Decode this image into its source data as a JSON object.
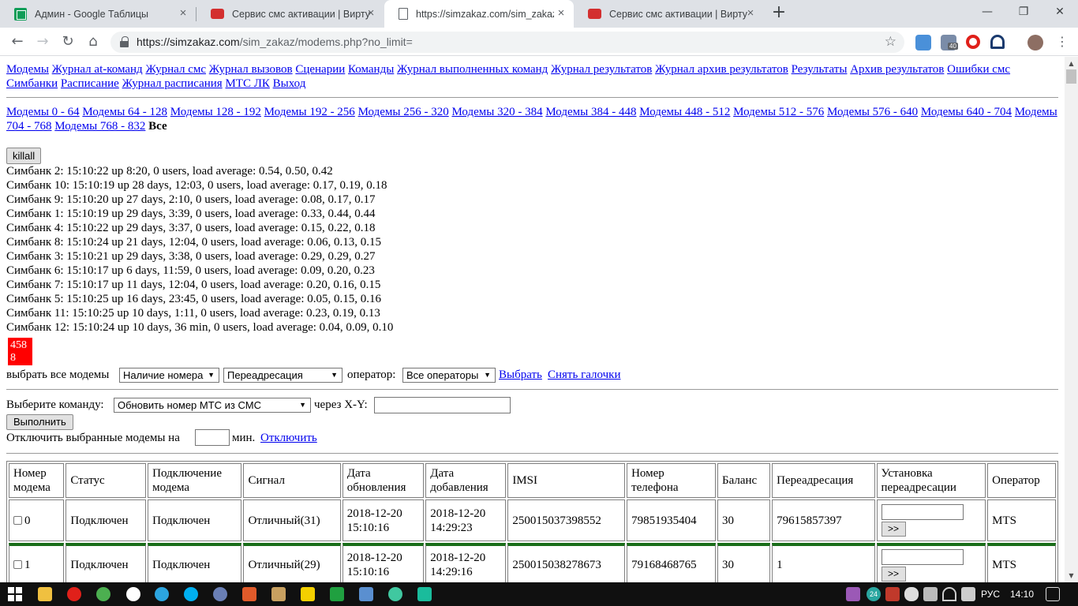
{
  "browser": {
    "tabs": [
      {
        "title": "Админ - Google Таблицы",
        "icon": "sheets-icon",
        "active": false
      },
      {
        "title": "Сервис смс активации | Виртуал",
        "icon": "sms-service-icon",
        "active": false
      },
      {
        "title": "https://simzakaz.com/sim_zakaz/",
        "icon": "document-icon",
        "active": true
      },
      {
        "title": "Сервис смс активации | Виртуа",
        "icon": "sms-service-icon",
        "active": false
      }
    ],
    "close_glyph": "×",
    "new_tab_glyph": "+",
    "window_controls": {
      "minimize": "—",
      "maximize": "❐",
      "close": "✕"
    },
    "nav": {
      "back": "←",
      "forward": "→",
      "reload": "↻",
      "home": "⌂"
    },
    "url_host": "https://simzakaz.com",
    "url_path": "/sim_zakaz/modems.php?no_limit=",
    "star_glyph": "☆",
    "extension_badge": "40"
  },
  "nav_links": [
    "Модемы",
    "Журнал at-команд",
    "Журнал смс",
    "Журнал вызовов",
    "Сценарии",
    "Команды",
    "Журнал выполненных команд",
    "Журнал результатов",
    "Журнал архив результатов",
    "Результаты",
    "Архив результатов",
    "Ошибки смс",
    "Симбанки",
    "Расписание",
    "Журнал расписания",
    "МТС ЛК",
    "Выход"
  ],
  "modem_ranges": [
    "Модемы 0 - 64",
    "Модемы 64 - 128",
    "Модемы 128 - 192",
    "Модемы 192 - 256",
    "Модемы 256 - 320",
    "Модемы 320 - 384",
    "Модемы 384 - 448",
    "Модемы 448 - 512",
    "Модемы 512 - 576",
    "Модемы 576 - 640",
    "Модемы 640 - 704",
    "Модемы 704 - 768",
    "Модемы 768 - 832"
  ],
  "modem_range_current": "Все",
  "killall_label": "killall",
  "simbank_status": [
    "Симбанк 2: 15:10:22 up 8:20, 0 users, load average: 0.54, 0.50, 0.42",
    "Симбанк 10: 15:10:19 up 28 days, 12:03, 0 users, load average: 0.17, 0.19, 0.18",
    "Симбанк 9: 15:10:20 up 27 days, 2:10, 0 users, load average: 0.08, 0.17, 0.17",
    "Симбанк 1: 15:10:19 up 29 days, 3:39, 0 users, load average: 0.33, 0.44, 0.44",
    "Симбанк 4: 15:10:22 up 29 days, 3:37, 0 users, load average: 0.15, 0.22, 0.18",
    "Симбанк 8: 15:10:24 up 21 days, 12:04, 0 users, load average: 0.06, 0.13, 0.15",
    "Симбанк 3: 15:10:21 up 29 days, 3:38, 0 users, load average: 0.29, 0.29, 0.27",
    "Симбанк 6: 15:10:17 up 6 days, 11:59, 0 users, load average: 0.09, 0.20, 0.23",
    "Симбанк 7: 15:10:17 up 11 days, 12:04, 0 users, load average: 0.20, 0.16, 0.15",
    "Симбанк 5: 15:10:25 up 16 days, 23:45, 0 users, load average: 0.05, 0.15, 0.16",
    "Симбанк 11: 15:10:25 up 10 days, 1:11, 0 users, load average: 0.23, 0.19, 0.13",
    "Симбанк 12: 15:10:24 up 10 days, 36 min, 0 users, load average: 0.04, 0.09, 0.10"
  ],
  "counter": {
    "line1": "458",
    "line2": "8"
  },
  "filters": {
    "select_all_label": "выбрать все модемы",
    "number_select": "Наличие номера",
    "forward_select": "Переадресация",
    "operator_label": "оператор:",
    "operator_select": "Все операторы",
    "select_link": "Выбрать",
    "unselect_link": "Снять галочки"
  },
  "command": {
    "label": "Выберите команду:",
    "select": "Обновить номер МТС из СМС",
    "via_label": "через X-Y:",
    "execute_button": "Выполнить",
    "disable_label": "Отключить выбранные модемы на",
    "minutes_label": "мин.",
    "disable_link": "Отключить"
  },
  "table": {
    "headers": [
      [
        "Номер",
        "модема"
      ],
      [
        "Статус"
      ],
      [
        "Подключение",
        "модема"
      ],
      [
        "Сигнал"
      ],
      [
        "Дата",
        "обновления"
      ],
      [
        "Дата",
        "добавления"
      ],
      [
        "IMSI"
      ],
      [
        "Номер",
        "телефона"
      ],
      [
        "Баланс"
      ],
      [
        "Переадресация"
      ],
      [
        "Установка",
        "переадресации"
      ],
      [
        "Оператор"
      ]
    ],
    "rows": [
      {
        "num": "0",
        "status": "Подключен",
        "connection": "Подключен",
        "signal": "Отличный(31)",
        "updated_date": "2018-12-20",
        "updated_time": "15:10:16",
        "added_date": "2018-12-20",
        "added_time": "14:29:23",
        "imsi": "250015037398552",
        "phone": "79851935404",
        "balance": "30",
        "forward": "79615857397",
        "operator": "MTS"
      },
      {
        "num": "1",
        "status": "Подключен",
        "connection": "Подключен",
        "signal": "Отличный(29)",
        "updated_date": "2018-12-20",
        "updated_time": "15:10:16",
        "added_date": "2018-12-20",
        "added_time": "14:29:16",
        "imsi": "250015038278673",
        "phone": "79168468765",
        "balance": "30",
        "forward": "1",
        "operator": "MTS"
      }
    ],
    "set_button": ">>"
  },
  "taskbar": {
    "lang": "РУС",
    "time": "14:10",
    "badge": "24"
  }
}
